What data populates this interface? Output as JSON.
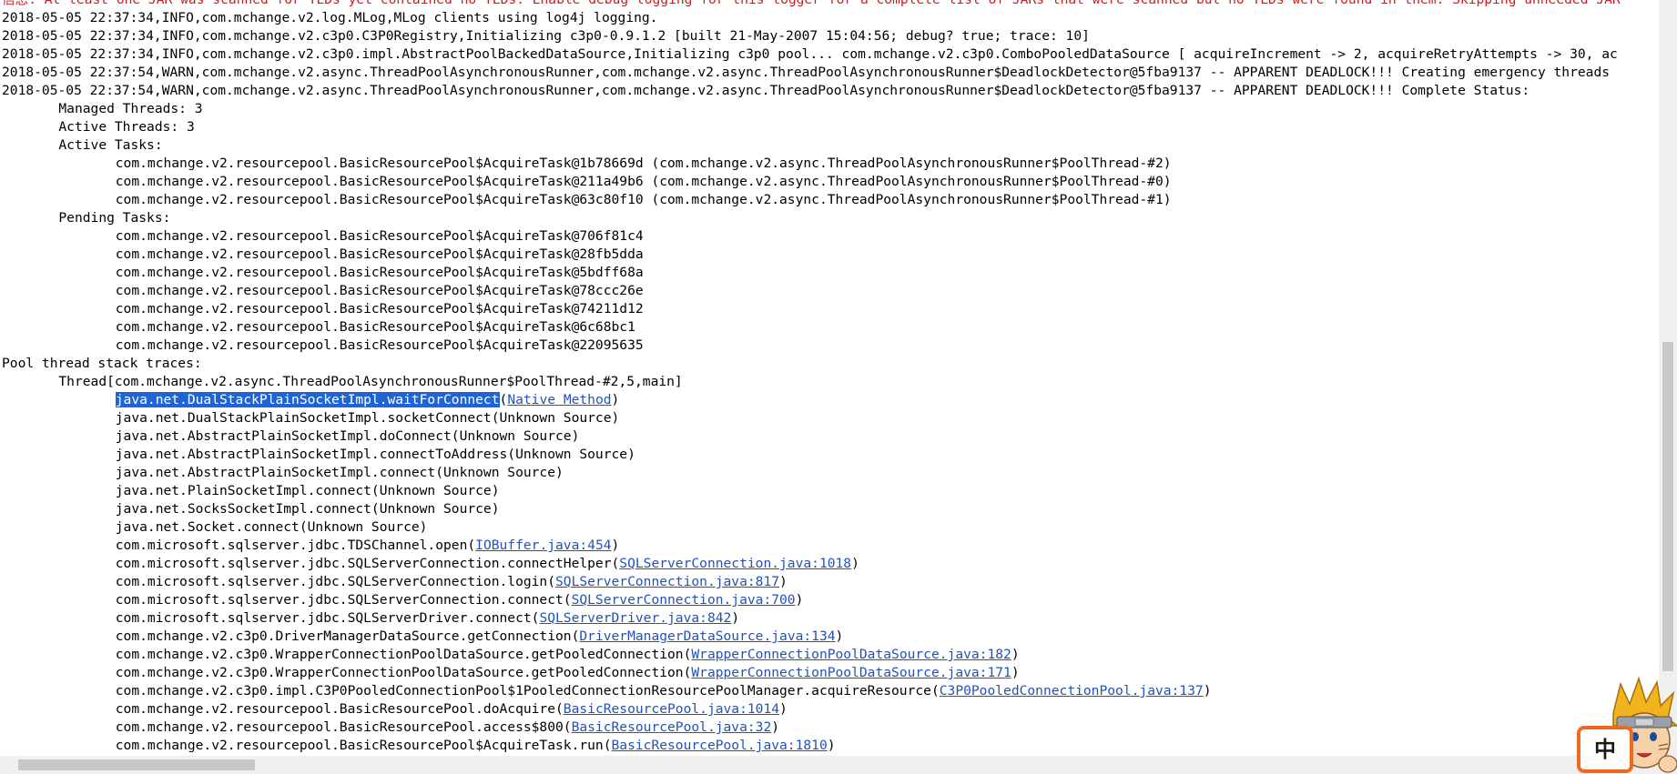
{
  "console": {
    "lines": [
      [
        {
          "t": "信息: At least one JAR was scanned for TLDs yet contained no TLDs. Enable debug logging for this logger for a complete list of JARs that were scanned but no TLDs were found in them. Skipping unneeded JAR",
          "c": "err"
        }
      ],
      [
        {
          "t": "2018-05-05 22:37:34,INFO,com.mchange.v2.log.MLog,MLog clients using log4j logging."
        }
      ],
      [
        {
          "t": "2018-05-05 22:37:34,INFO,com.mchange.v2.c3p0.C3P0Registry,Initializing c3p0-0.9.1.2 [built 21-May-2007 15:04:56; debug? true; trace: 10]"
        }
      ],
      [
        {
          "t": "2018-05-05 22:37:34,INFO,com.mchange.v2.c3p0.impl.AbstractPoolBackedDataSource,Initializing c3p0 pool... com.mchange.v2.c3p0.ComboPooledDataSource [ acquireIncrement -> 2, acquireRetryAttempts -> 30, ac"
        }
      ],
      [
        {
          "t": "2018-05-05 22:37:54,WARN,com.mchange.v2.async.ThreadPoolAsynchronousRunner,com.mchange.v2.async.ThreadPoolAsynchronousRunner$DeadlockDetector@5fba9137 -- APPARENT DEADLOCK!!! Creating emergency threads"
        }
      ],
      [
        {
          "t": "2018-05-05 22:37:54,WARN,com.mchange.v2.async.ThreadPoolAsynchronousRunner,com.mchange.v2.async.ThreadPoolAsynchronousRunner$DeadlockDetector@5fba9137 -- APPARENT DEADLOCK!!! Complete Status:"
        }
      ],
      [
        {
          "t": "\tManaged Threads: 3"
        }
      ],
      [
        {
          "t": "\tActive Threads: 3"
        }
      ],
      [
        {
          "t": "\tActive Tasks: "
        }
      ],
      [
        {
          "t": "\t\tcom.mchange.v2.resourcepool.BasicResourcePool$AcquireTask@1b78669d (com.mchange.v2.async.ThreadPoolAsynchronousRunner$PoolThread-#2)"
        }
      ],
      [
        {
          "t": "\t\tcom.mchange.v2.resourcepool.BasicResourcePool$AcquireTask@211a49b6 (com.mchange.v2.async.ThreadPoolAsynchronousRunner$PoolThread-#0)"
        }
      ],
      [
        {
          "t": "\t\tcom.mchange.v2.resourcepool.BasicResourcePool$AcquireTask@63c80f10 (com.mchange.v2.async.ThreadPoolAsynchronousRunner$PoolThread-#1)"
        }
      ],
      [
        {
          "t": "\tPending Tasks: "
        }
      ],
      [
        {
          "t": "\t\tcom.mchange.v2.resourcepool.BasicResourcePool$AcquireTask@706f81c4"
        }
      ],
      [
        {
          "t": "\t\tcom.mchange.v2.resourcepool.BasicResourcePool$AcquireTask@28fb5dda"
        }
      ],
      [
        {
          "t": "\t\tcom.mchange.v2.resourcepool.BasicResourcePool$AcquireTask@5bdff68a"
        }
      ],
      [
        {
          "t": "\t\tcom.mchange.v2.resourcepool.BasicResourcePool$AcquireTask@78ccc26e"
        }
      ],
      [
        {
          "t": "\t\tcom.mchange.v2.resourcepool.BasicResourcePool$AcquireTask@74211d12"
        }
      ],
      [
        {
          "t": "\t\tcom.mchange.v2.resourcepool.BasicResourcePool$AcquireTask@6c68bc1"
        }
      ],
      [
        {
          "t": "\t\tcom.mchange.v2.resourcepool.BasicResourcePool$AcquireTask@22095635"
        }
      ],
      [
        {
          "t": "Pool thread stack traces:"
        }
      ],
      [
        {
          "t": "\tThread[com.mchange.v2.async.ThreadPoolAsynchronousRunner$PoolThread-#2,5,main]"
        }
      ],
      [
        {
          "t": "\t\t"
        },
        {
          "t": "java.net.DualStackPlainSocketImpl.waitForConnect",
          "c": "sel"
        },
        {
          "t": "("
        },
        {
          "t": "Native Method",
          "c": "link"
        },
        {
          "t": ")"
        }
      ],
      [
        {
          "t": "\t\tjava.net.DualStackPlainSocketImpl.socketConnect(Unknown Source)"
        }
      ],
      [
        {
          "t": "\t\tjava.net.AbstractPlainSocketImpl.doConnect(Unknown Source)"
        }
      ],
      [
        {
          "t": "\t\tjava.net.AbstractPlainSocketImpl.connectToAddress(Unknown Source)"
        }
      ],
      [
        {
          "t": "\t\tjava.net.AbstractPlainSocketImpl.connect(Unknown Source)"
        }
      ],
      [
        {
          "t": "\t\tjava.net.PlainSocketImpl.connect(Unknown Source)"
        }
      ],
      [
        {
          "t": "\t\tjava.net.SocksSocketImpl.connect(Unknown Source)"
        }
      ],
      [
        {
          "t": "\t\tjava.net.Socket.connect(Unknown Source)"
        }
      ],
      [
        {
          "t": "\t\tcom.microsoft.sqlserver.jdbc.TDSChannel.open("
        },
        {
          "t": "IOBuffer.java:454",
          "c": "link"
        },
        {
          "t": ")"
        }
      ],
      [
        {
          "t": "\t\tcom.microsoft.sqlserver.jdbc.SQLServerConnection.connectHelper("
        },
        {
          "t": "SQLServerConnection.java:1018",
          "c": "link"
        },
        {
          "t": ")"
        }
      ],
      [
        {
          "t": "\t\tcom.microsoft.sqlserver.jdbc.SQLServerConnection.login("
        },
        {
          "t": "SQLServerConnection.java:817",
          "c": "link"
        },
        {
          "t": ")"
        }
      ],
      [
        {
          "t": "\t\tcom.microsoft.sqlserver.jdbc.SQLServerConnection.connect("
        },
        {
          "t": "SQLServerConnection.java:700",
          "c": "link"
        },
        {
          "t": ")"
        }
      ],
      [
        {
          "t": "\t\tcom.microsoft.sqlserver.jdbc.SQLServerDriver.connect("
        },
        {
          "t": "SQLServerDriver.java:842",
          "c": "link"
        },
        {
          "t": ")"
        }
      ],
      [
        {
          "t": "\t\tcom.mchange.v2.c3p0.DriverManagerDataSource.getConnection("
        },
        {
          "t": "DriverManagerDataSource.java:134",
          "c": "link"
        },
        {
          "t": ")"
        }
      ],
      [
        {
          "t": "\t\tcom.mchange.v2.c3p0.WrapperConnectionPoolDataSource.getPooledConnection("
        },
        {
          "t": "WrapperConnectionPoolDataSource.java:182",
          "c": "link"
        },
        {
          "t": ")"
        }
      ],
      [
        {
          "t": "\t\tcom.mchange.v2.c3p0.WrapperConnectionPoolDataSource.getPooledConnection("
        },
        {
          "t": "WrapperConnectionPoolDataSource.java:171",
          "c": "link"
        },
        {
          "t": ")"
        }
      ],
      [
        {
          "t": "\t\tcom.mchange.v2.c3p0.impl.C3P0PooledConnectionPool$1PooledConnectionResourcePoolManager.acquireResource("
        },
        {
          "t": "C3P0PooledConnectionPool.java:137",
          "c": "link"
        },
        {
          "t": ")"
        }
      ],
      [
        {
          "t": "\t\tcom.mchange.v2.resourcepool.BasicResourcePool.doAcquire("
        },
        {
          "t": "BasicResourcePool.java:1014",
          "c": "link"
        },
        {
          "t": ")"
        }
      ],
      [
        {
          "t": "\t\tcom.mchange.v2.resourcepool.BasicResourcePool.access$800("
        },
        {
          "t": "BasicResourcePool.java:32",
          "c": "link"
        },
        {
          "t": ")"
        }
      ],
      [
        {
          "t": "\t\tcom.mchange.v2.resourcepool.BasicResourcePool$AcquireTask.run("
        },
        {
          "t": "BasicResourcePool.java:1810",
          "c": "link"
        },
        {
          "t": ")"
        }
      ]
    ]
  },
  "ime": {
    "label": "中",
    "border_color": "#ee6a1f"
  },
  "colors": {
    "error_text": "#d01c1c",
    "link": "#2451b8",
    "selection_bg": "#1c64d8"
  }
}
